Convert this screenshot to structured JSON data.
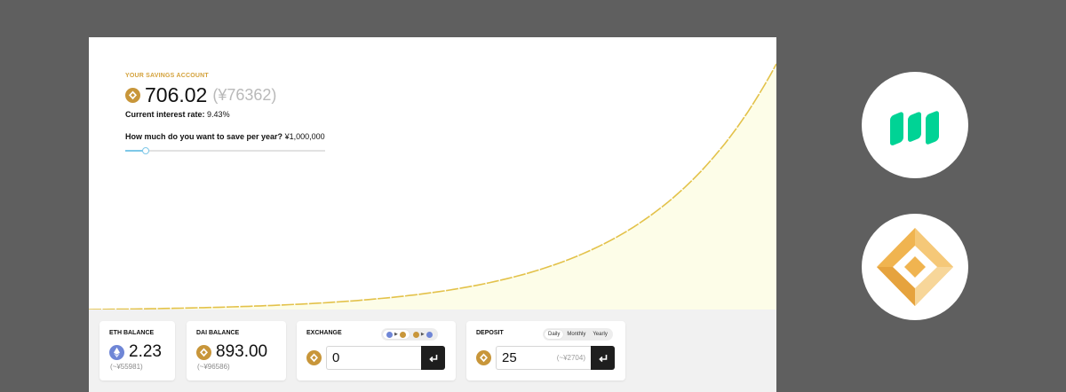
{
  "savings": {
    "label": "YOUR SAVINGS ACCOUNT",
    "amount": "706.02",
    "amount_yen": "(¥76362)",
    "rate_label": "Current interest rate:",
    "rate_value": "9.43%",
    "question_label": "How much do you want to save per year?",
    "question_value": "¥1,000,000",
    "slider_fraction": 0.1
  },
  "eth_balance": {
    "title": "ETH BALANCE",
    "value": "2.23",
    "yen": "(~¥55981)"
  },
  "dai_balance": {
    "title": "DAI BALANCE",
    "value": "893.00",
    "yen": "(~¥96586)"
  },
  "exchange": {
    "title": "EXCHANGE",
    "input_value": "0",
    "modes": [
      {
        "from": "eth",
        "to": "dai",
        "active": true
      },
      {
        "from": "dai",
        "to": "eth",
        "active": false
      }
    ]
  },
  "deposit": {
    "title": "DEPOSIT",
    "periods": [
      "Daily",
      "Monthly",
      "Yearly"
    ],
    "active_period": "Daily",
    "input_value": "25",
    "input_hint": "(~¥2704)"
  },
  "icons": {
    "eth": "ethereum-icon",
    "dai": "dai-coin-icon",
    "compound_logo": "compound-logo",
    "dai_logo": "dai-diamond-logo",
    "enter": "enter-arrow-icon"
  },
  "colors": {
    "accent_gold": "#d4a23c",
    "curve": "#e3c24a",
    "curve_fill": "#fdfde8",
    "compound_green": "#00d395",
    "dai_gold": "#f0b450",
    "eth_blue": "#6f86d6"
  }
}
